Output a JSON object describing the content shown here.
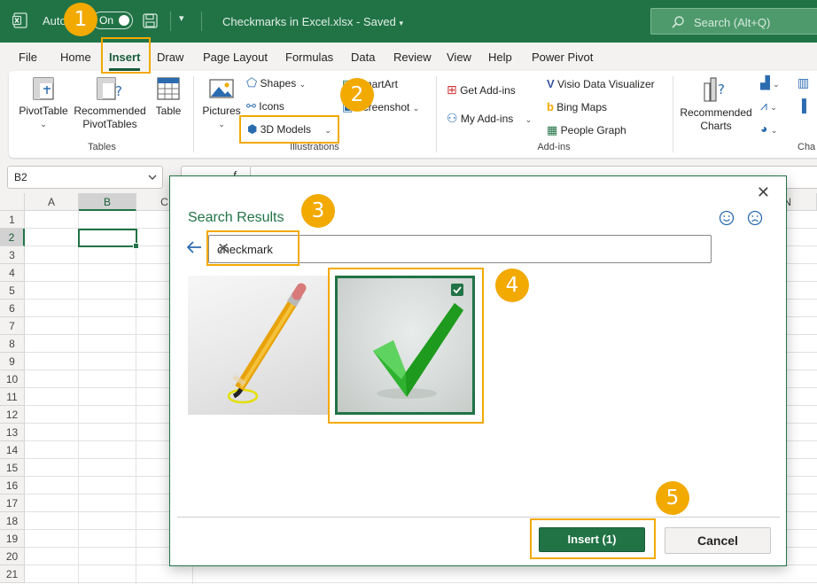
{
  "titlebar": {
    "autosave_label": "AutoSave",
    "toggle_state": "On",
    "filename": "Checkmarks in Excel.xlsx",
    "saved_status": "Saved",
    "search_placeholder": "Search (Alt+Q)"
  },
  "menu": {
    "items": [
      "File",
      "Home",
      "Insert",
      "Draw",
      "Page Layout",
      "Formulas",
      "Data",
      "Review",
      "View",
      "Help",
      "Power Pivot"
    ],
    "active": "Insert"
  },
  "ribbon": {
    "tables": {
      "pivot_table": "PivotTable",
      "recommended_pivot_1": "Recommended",
      "recommended_pivot_2": "PivotTables",
      "table": "Table",
      "group_label": "Tables"
    },
    "illustrations": {
      "pictures": "Pictures",
      "shapes": "Shapes",
      "icons": "Icons",
      "models_3d": "3D Models",
      "smartart": "SmartArt",
      "screenshot": "Screenshot",
      "group_label": "Illustrations"
    },
    "addins": {
      "get_addins": "Get Add-ins",
      "my_addins": "My Add-ins",
      "visio": "Visio Data Visualizer",
      "bing_maps": "Bing Maps",
      "people_graph": "People Graph",
      "group_label": "Add-ins"
    },
    "charts": {
      "recommended_1": "Recommended",
      "recommended_2": "Charts",
      "group_label": "Cha"
    }
  },
  "formula_bar": {
    "name_box": "B2",
    "fx": "f"
  },
  "grid": {
    "columns": [
      "A",
      "B",
      "C",
      "N"
    ],
    "rows": [
      "1",
      "2",
      "3",
      "4",
      "5",
      "6",
      "7",
      "8",
      "9",
      "10",
      "11",
      "12",
      "13",
      "14",
      "15",
      "16",
      "17",
      "18",
      "19",
      "20",
      "21"
    ],
    "selected_cell": "B2"
  },
  "dialog": {
    "title": "Search Results",
    "search_value": "checkmark",
    "selected_count_label": "Insert (1)",
    "cancel_label": "Cancel",
    "close_glyph": "✕",
    "clear_glyph": "✕",
    "smile_icon": "smile-icon",
    "frown_icon": "frown-icon"
  },
  "steps": [
    "1",
    "2",
    "3",
    "4",
    "5"
  ],
  "colors": {
    "excel_green": "#217346",
    "dark_green": "#185c37",
    "annotation_orange": "#f2a900",
    "ribbon_bg": "#f3f2f1"
  }
}
